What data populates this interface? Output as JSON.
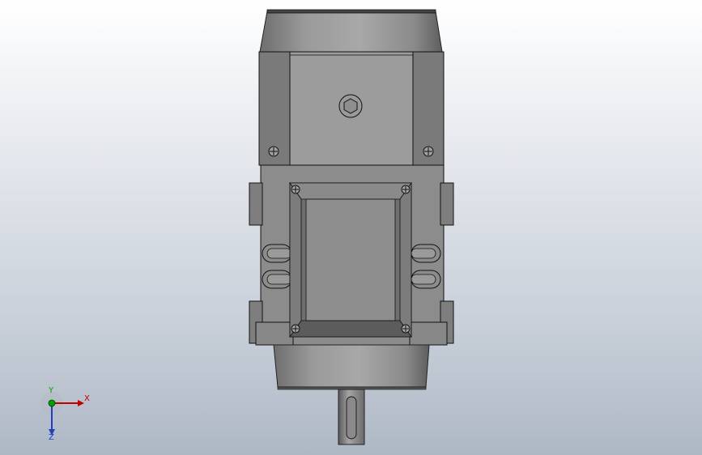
{
  "viewport": {
    "name": "3D model view",
    "background_top": "#ffffff",
    "background_bottom": "#aeb8c5"
  },
  "model": {
    "description_icon": "geared-motor-top-view",
    "body_color": "#8c8c8c",
    "edge_color": "#000000"
  },
  "triad": {
    "x_label": "X",
    "y_label": "Y",
    "z_label": "Z",
    "x_color": "#c00000",
    "y_color": "#00a000",
    "z_color": "#2040c0"
  }
}
